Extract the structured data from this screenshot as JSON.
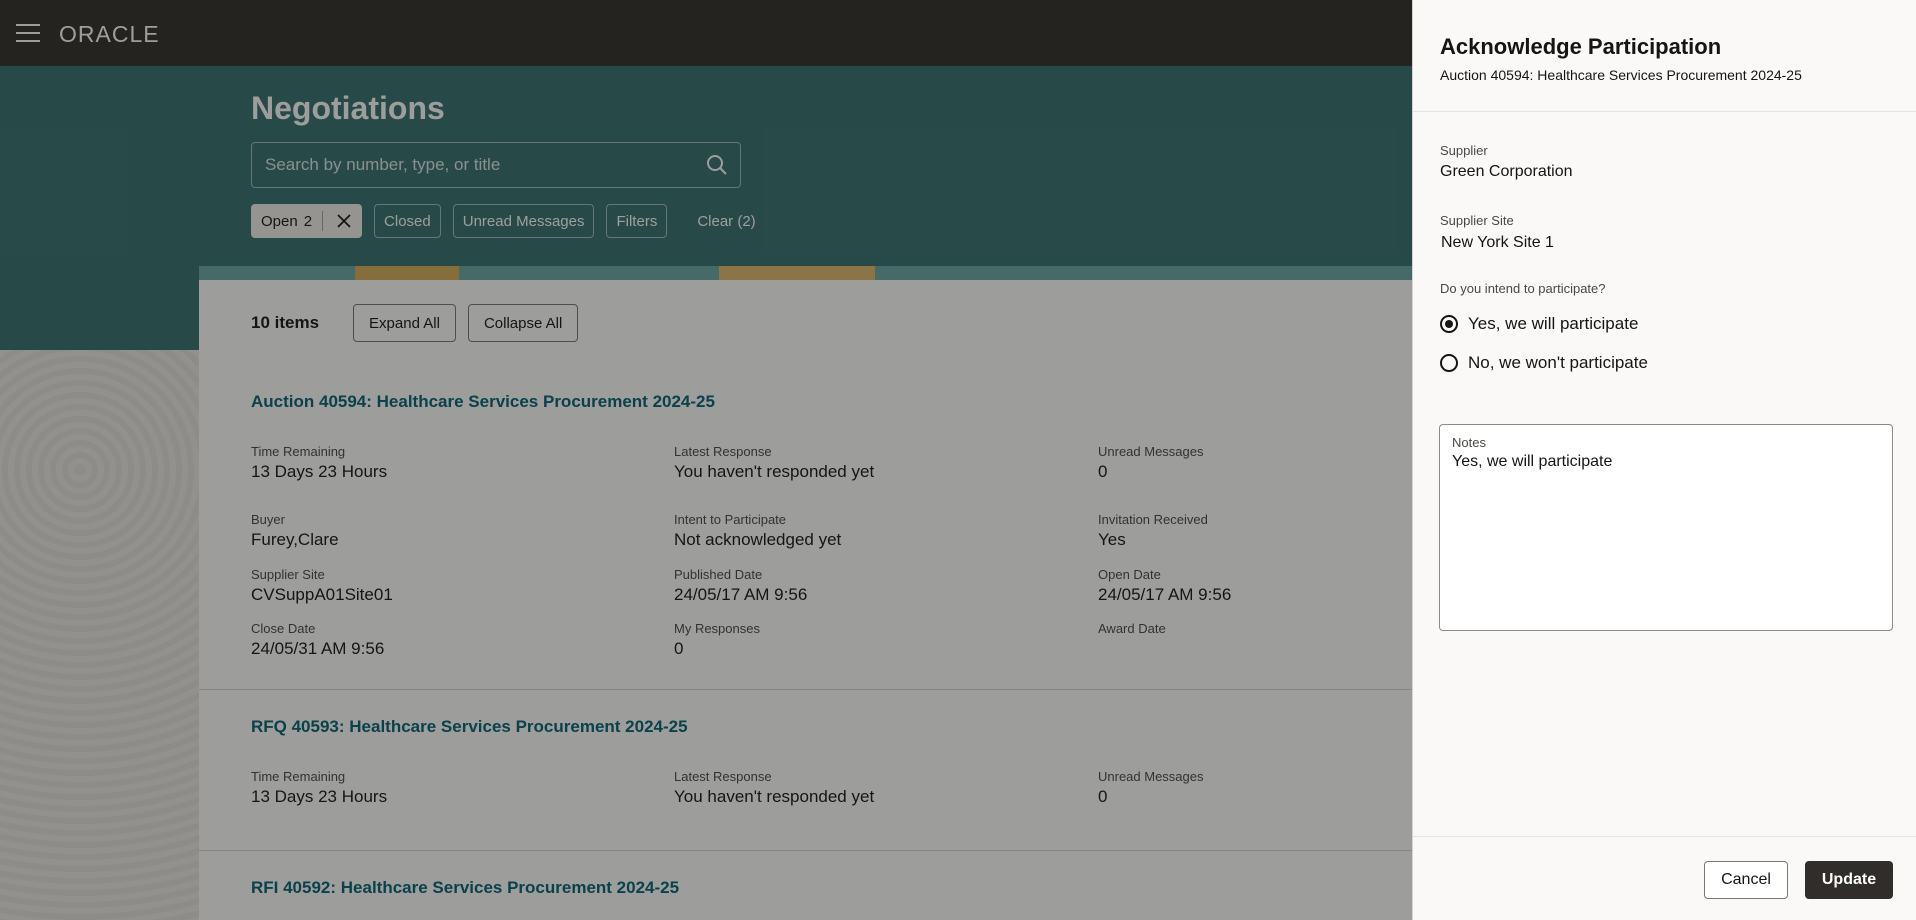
{
  "header": {
    "logo": "ORACLE",
    "menu_icon": "hamburger-menu-icon"
  },
  "page": {
    "title": "Negotiations",
    "search_placeholder": "Search by number, type, or title",
    "search_icon": "search-icon"
  },
  "filters": {
    "open_label": "Open",
    "open_count": "2",
    "closed_label": "Closed",
    "unread_label": "Unread Messages",
    "filters_label": "Filters",
    "clear_label": "Clear (2)"
  },
  "toolbar": {
    "items_count": "10 items",
    "expand_all": "Expand All",
    "collapse_all": "Collapse All"
  },
  "negotiations": [
    {
      "title": "Auction 40594: Healthcare Services Procurement 2024-25",
      "fields": [
        {
          "label": "Time Remaining",
          "value": "13 Days 23 Hours"
        },
        {
          "label": "Latest Response",
          "value": "You haven't responded yet"
        },
        {
          "label": "Unread Messages",
          "value": "0"
        },
        {
          "label": "Buyer",
          "value": "Furey,Clare"
        },
        {
          "label": "Intent to Participate",
          "value": "Not acknowledged yet"
        },
        {
          "label": "Invitation Received",
          "value": "Yes"
        },
        {
          "label": "Supplier Site",
          "value": "CVSuppA01Site01"
        },
        {
          "label": "Published Date",
          "value": "24/05/17 AM 9:56"
        },
        {
          "label": "Open Date",
          "value": "24/05/17 AM 9:56"
        },
        {
          "label": "Close Date",
          "value": "24/05/31 AM 9:56"
        },
        {
          "label": "My Responses",
          "value": "0"
        },
        {
          "label": "Award Date",
          "value": ""
        }
      ]
    },
    {
      "title": "RFQ 40593: Healthcare Services Procurement 2024-25",
      "fields": [
        {
          "label": "Time Remaining",
          "value": "13 Days 23 Hours"
        },
        {
          "label": "Latest Response",
          "value": "You haven't responded yet"
        },
        {
          "label": "Unread Messages",
          "value": "0"
        }
      ]
    },
    {
      "title": "RFI 40592: Healthcare Services Procurement 2024-25"
    }
  ],
  "drawer": {
    "title": "Acknowledge Participation",
    "subtitle": "Auction 40594: Healthcare Services Procurement 2024-25",
    "supplier_label": "Supplier",
    "supplier_value": "Green Corporation",
    "site_label": "Supplier Site",
    "site_value": "New York Site 1",
    "question": "Do you intend to participate?",
    "option_yes": "Yes, we will participate",
    "option_no": "No, we won't participate",
    "selected_option": "yes",
    "notes_label": "Notes",
    "notes_value": "Yes, we will participate",
    "cancel_label": "Cancel",
    "update_label": "Update"
  },
  "colors": {
    "topbar": "#312d2a",
    "hero": "#35706f",
    "link": "#026174",
    "primary_button": "#312d2a"
  }
}
